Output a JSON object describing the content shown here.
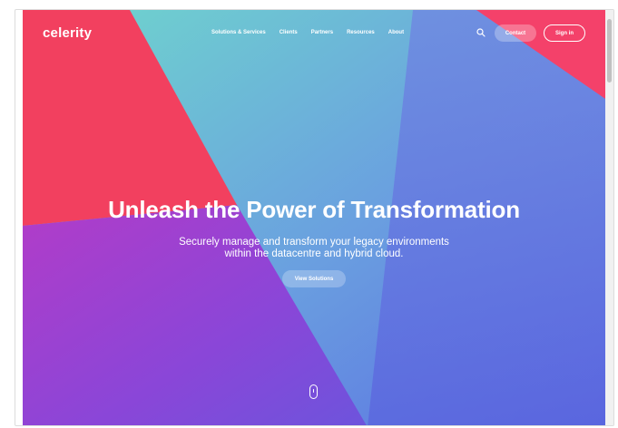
{
  "brand": {
    "logo": "celerity"
  },
  "nav": {
    "items": [
      {
        "label": "Solutions & Services"
      },
      {
        "label": "Clients"
      },
      {
        "label": "Partners"
      },
      {
        "label": "Resources"
      },
      {
        "label": "About"
      }
    ],
    "search_icon": "search-icon",
    "contact_label": "Contact",
    "signin_label": "Sign in"
  },
  "hero": {
    "headline": "Unleash the Power of Transformation",
    "subtitle_line1": "Securely manage and transform your legacy environments",
    "subtitle_line2": "within the datacentre and hybrid cloud.",
    "cta_label": "View Solutions",
    "scroll_icon": "mouse-scroll-icon"
  },
  "colors": {
    "coral": "#f2405e",
    "teal": "#6fd6cf",
    "blue": "#5a6fe0",
    "purple": "#8b48d6"
  }
}
